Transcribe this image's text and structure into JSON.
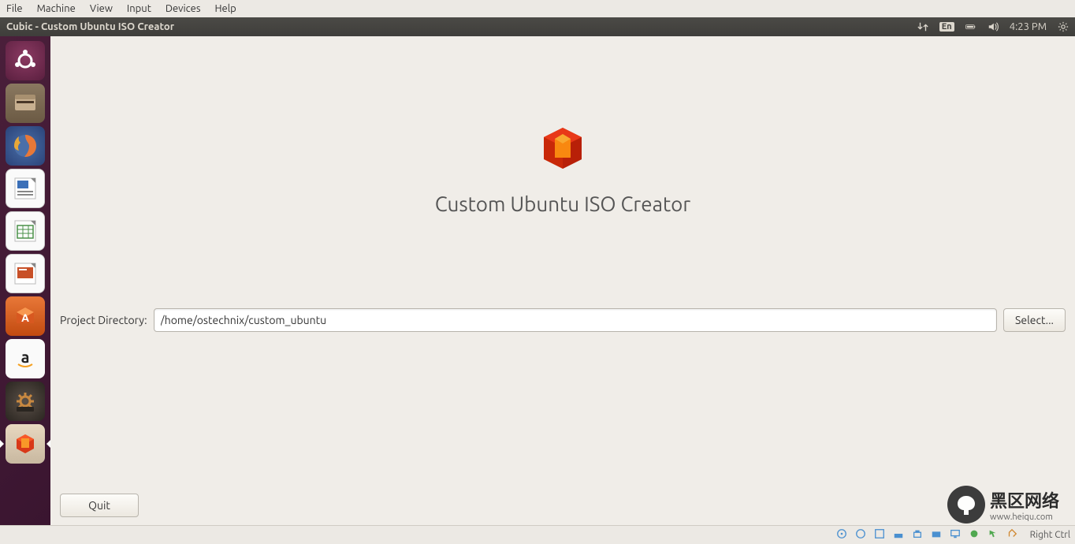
{
  "vbox_menu": {
    "file": "File",
    "machine": "Machine",
    "view": "View",
    "input": "Input",
    "devices": "Devices",
    "help": "Help"
  },
  "panel": {
    "title": "Cubic - Custom Ubuntu ISO Creator",
    "lang": "En",
    "time": "4:23 PM"
  },
  "launcher": {
    "items": [
      "ubuntu-dash",
      "files",
      "firefox",
      "writer",
      "calc",
      "impress",
      "software-center",
      "amazon",
      "settings",
      "cubic"
    ]
  },
  "app": {
    "title": "Custom Ubuntu ISO Creator",
    "project_dir_label": "Project Directory:",
    "project_dir_value": "/home/ostechnix/custom_ubuntu",
    "select_label": "Select...",
    "quit_label": "Quit"
  },
  "vbox_status": {
    "right_ctrl": "Right Ctrl"
  },
  "watermark": {
    "text": "黑区网络",
    "url": "www.heiqu.com"
  }
}
